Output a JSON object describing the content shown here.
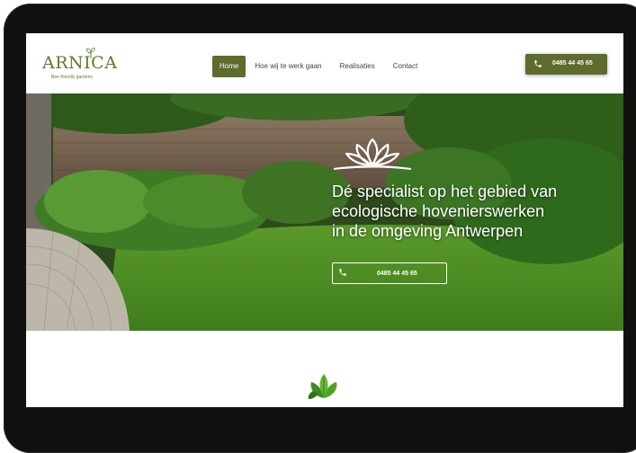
{
  "logo": {
    "text": "ARNICA",
    "tagline": "Bee friendly gardens"
  },
  "nav": {
    "items": [
      {
        "label": "Home",
        "active": true
      },
      {
        "label": "Hoe wij te werk gaan",
        "active": false
      },
      {
        "label": "Realisaties",
        "active": false
      },
      {
        "label": "Contact",
        "active": false
      }
    ]
  },
  "header_phone": {
    "number": "0485 44 45 65",
    "icon": "phone-icon"
  },
  "hero": {
    "heading_lines": [
      "Dé specialist op het gebied van",
      "ecologische hovenierswerken",
      "in de omgeving Antwerpen"
    ],
    "phone": {
      "number": "0485 44 45 65",
      "icon": "phone-icon"
    },
    "emblem_icon": "lotus-leaf-icon"
  },
  "section_icon": "green-leaves-icon",
  "colors": {
    "brand": "#5d6b2c",
    "frame": "#101010",
    "text": "#444444"
  }
}
